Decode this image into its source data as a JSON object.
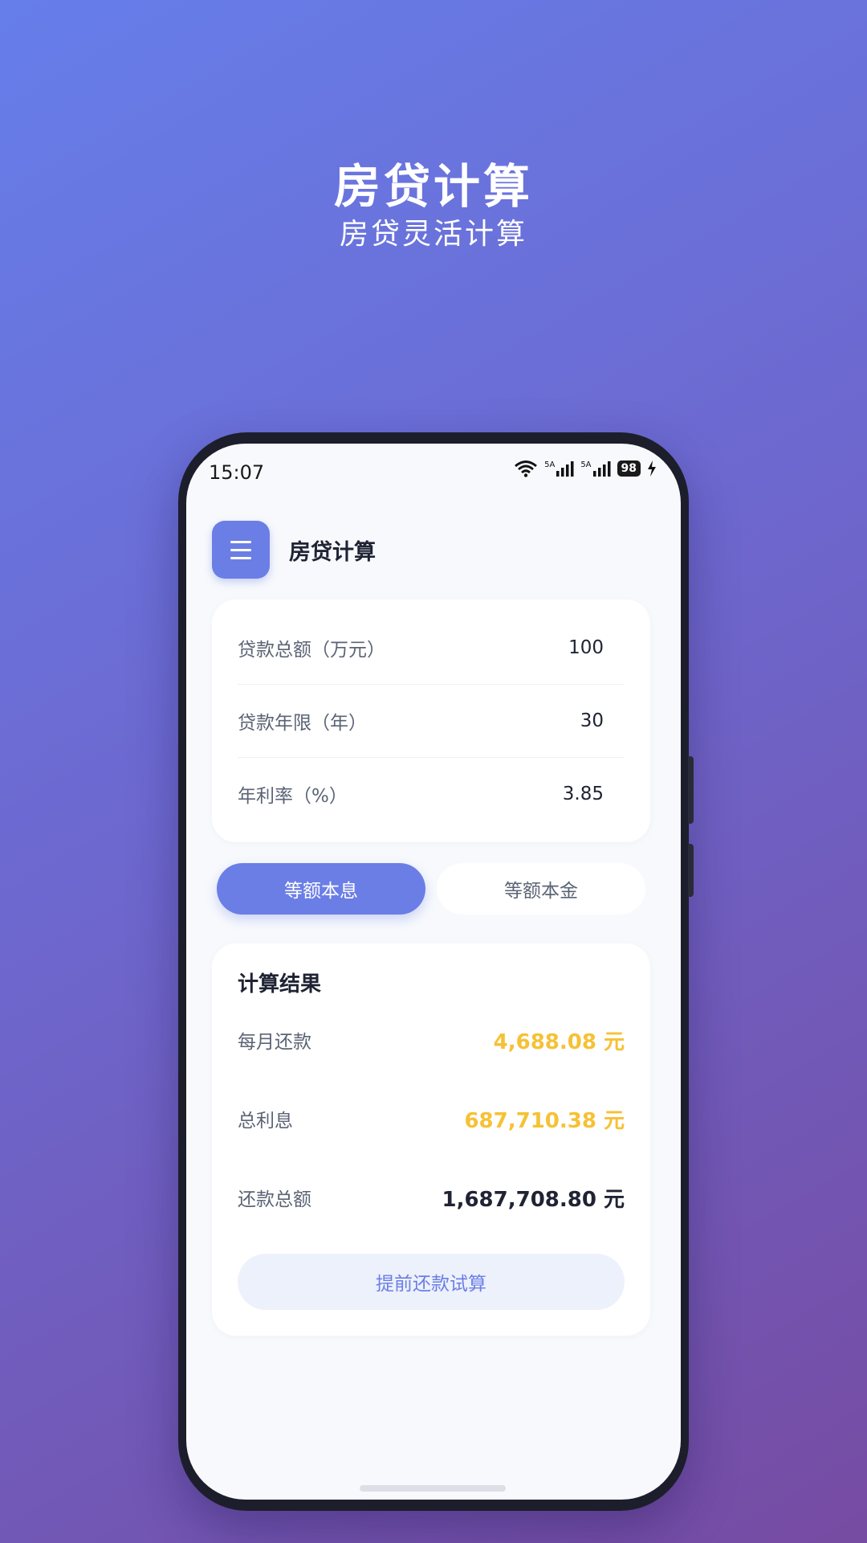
{
  "promo": {
    "title": "房贷计算",
    "subtitle": "房贷灵活计算"
  },
  "status_bar": {
    "time": "15:07",
    "signal_label_1": "5A",
    "signal_label_2": "5A",
    "battery": "98",
    "icons": [
      "wifi-icon",
      "signal-icon",
      "signal-icon",
      "battery-icon",
      "charging-icon"
    ]
  },
  "header": {
    "title": "房贷计算",
    "menu_icon": "menu-icon"
  },
  "inputs": [
    {
      "label": "贷款总额（万元）",
      "value": "100"
    },
    {
      "label": "贷款年限（年）",
      "value": "30"
    },
    {
      "label": "年利率（%）",
      "value": "3.85"
    }
  ],
  "repayment_methods": {
    "options": [
      "等额本息",
      "等额本金"
    ],
    "selected": "等额本息"
  },
  "results": {
    "title": "计算结果",
    "rows": [
      {
        "label": "每月还款",
        "value": "4,688.08 元"
      },
      {
        "label": "总利息",
        "value": "687,710.38 元"
      },
      {
        "label": "还款总额",
        "value": "1,687,708.80 元"
      }
    ],
    "prepay_button": "提前还款试算"
  },
  "colors": {
    "primary": "#6b7ee6",
    "highlight": "#f6c135",
    "text_dark": "#1f2333",
    "text_muted": "#5b6475",
    "bg_gradient_start": "#667eea",
    "bg_gradient_end": "#764ba2"
  }
}
